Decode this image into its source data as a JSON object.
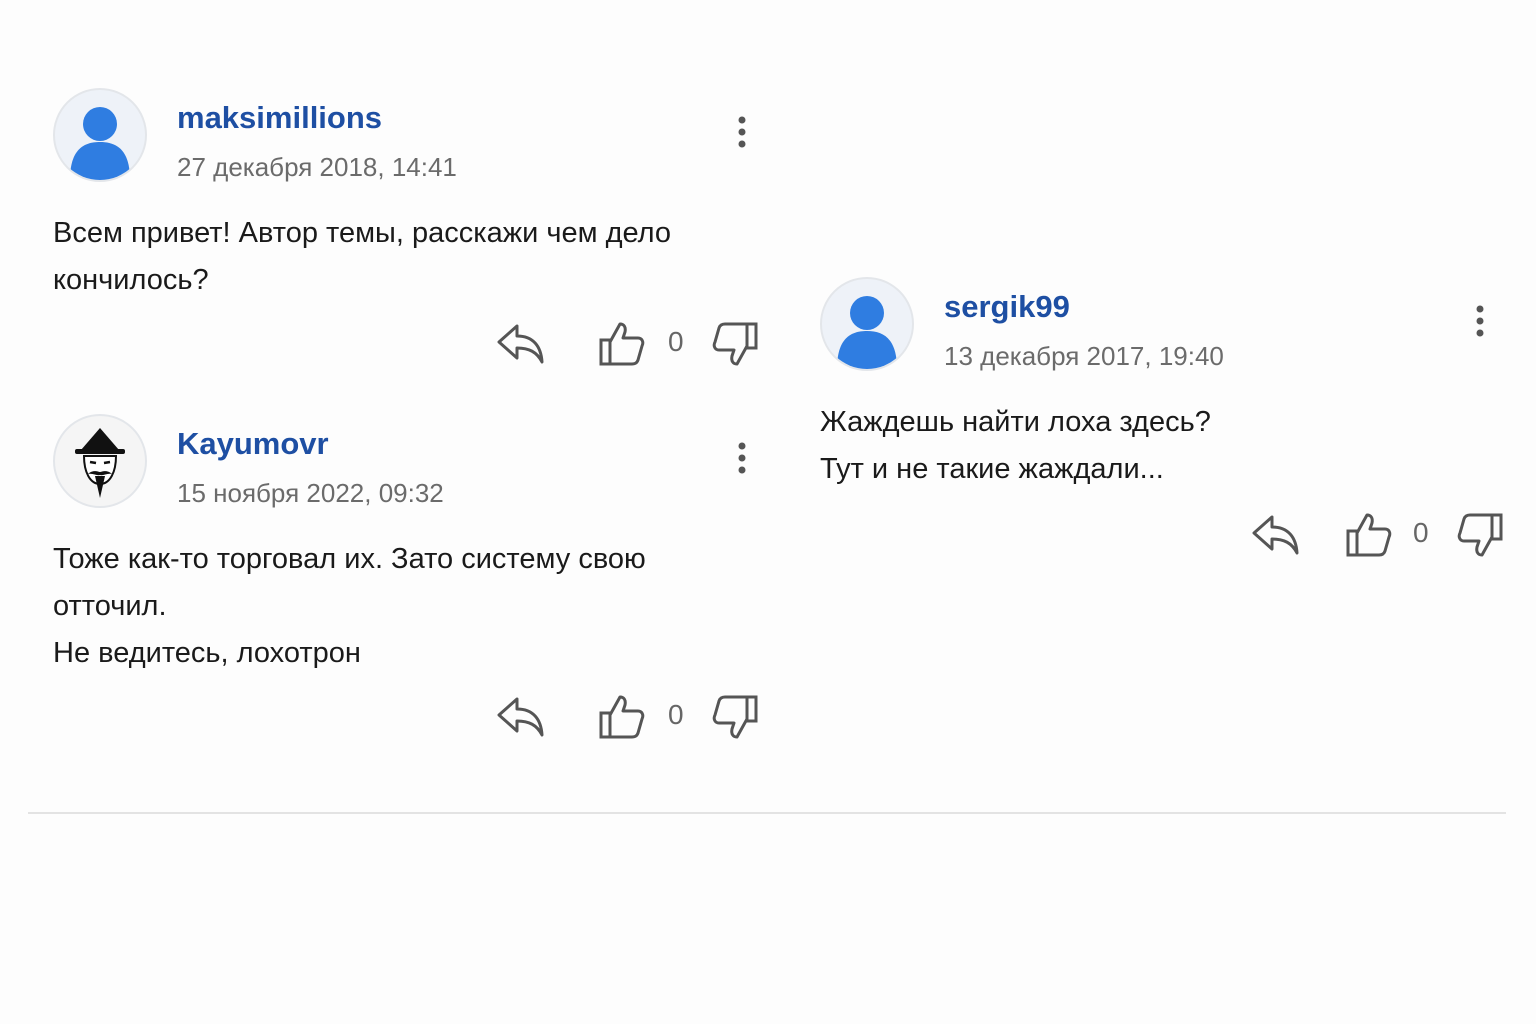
{
  "comments": [
    {
      "username": "maksimillions",
      "date": "27 декабря 2018, 14:41",
      "text_lines": [
        "Всем привет! Автор темы, расскажи чем дело",
        "кончилось?"
      ],
      "likes": "0",
      "avatar": "default-user-avatar"
    },
    {
      "username": "Kayumovr",
      "date": "15 ноября 2022, 09:32",
      "text_lines": [
        "Тоже как-то торговал их. Зато систему свою",
        "отточил.",
        "Не ведитесь, лохотрон"
      ],
      "likes": "0",
      "avatar": "custom-avatar-man-in-hat"
    },
    {
      "username": "sergik99",
      "date": "13 декабря 2017, 19:40",
      "text_lines": [
        "Жаждешь найти лоха здесь?",
        "Тут и не такие жаждали..."
      ],
      "likes": "0",
      "avatar": "default-user-avatar"
    }
  ],
  "icons": {
    "menu": "more-vertical-icon",
    "reply": "reply-icon",
    "like": "thumbs-up-icon",
    "dislike": "thumbs-down-icon"
  },
  "colors": {
    "username": "#1e4fa3",
    "avatar_blue": "#2f7de1",
    "date": "#6b6b6b",
    "text": "#1a1a1a",
    "icon": "#555555"
  }
}
